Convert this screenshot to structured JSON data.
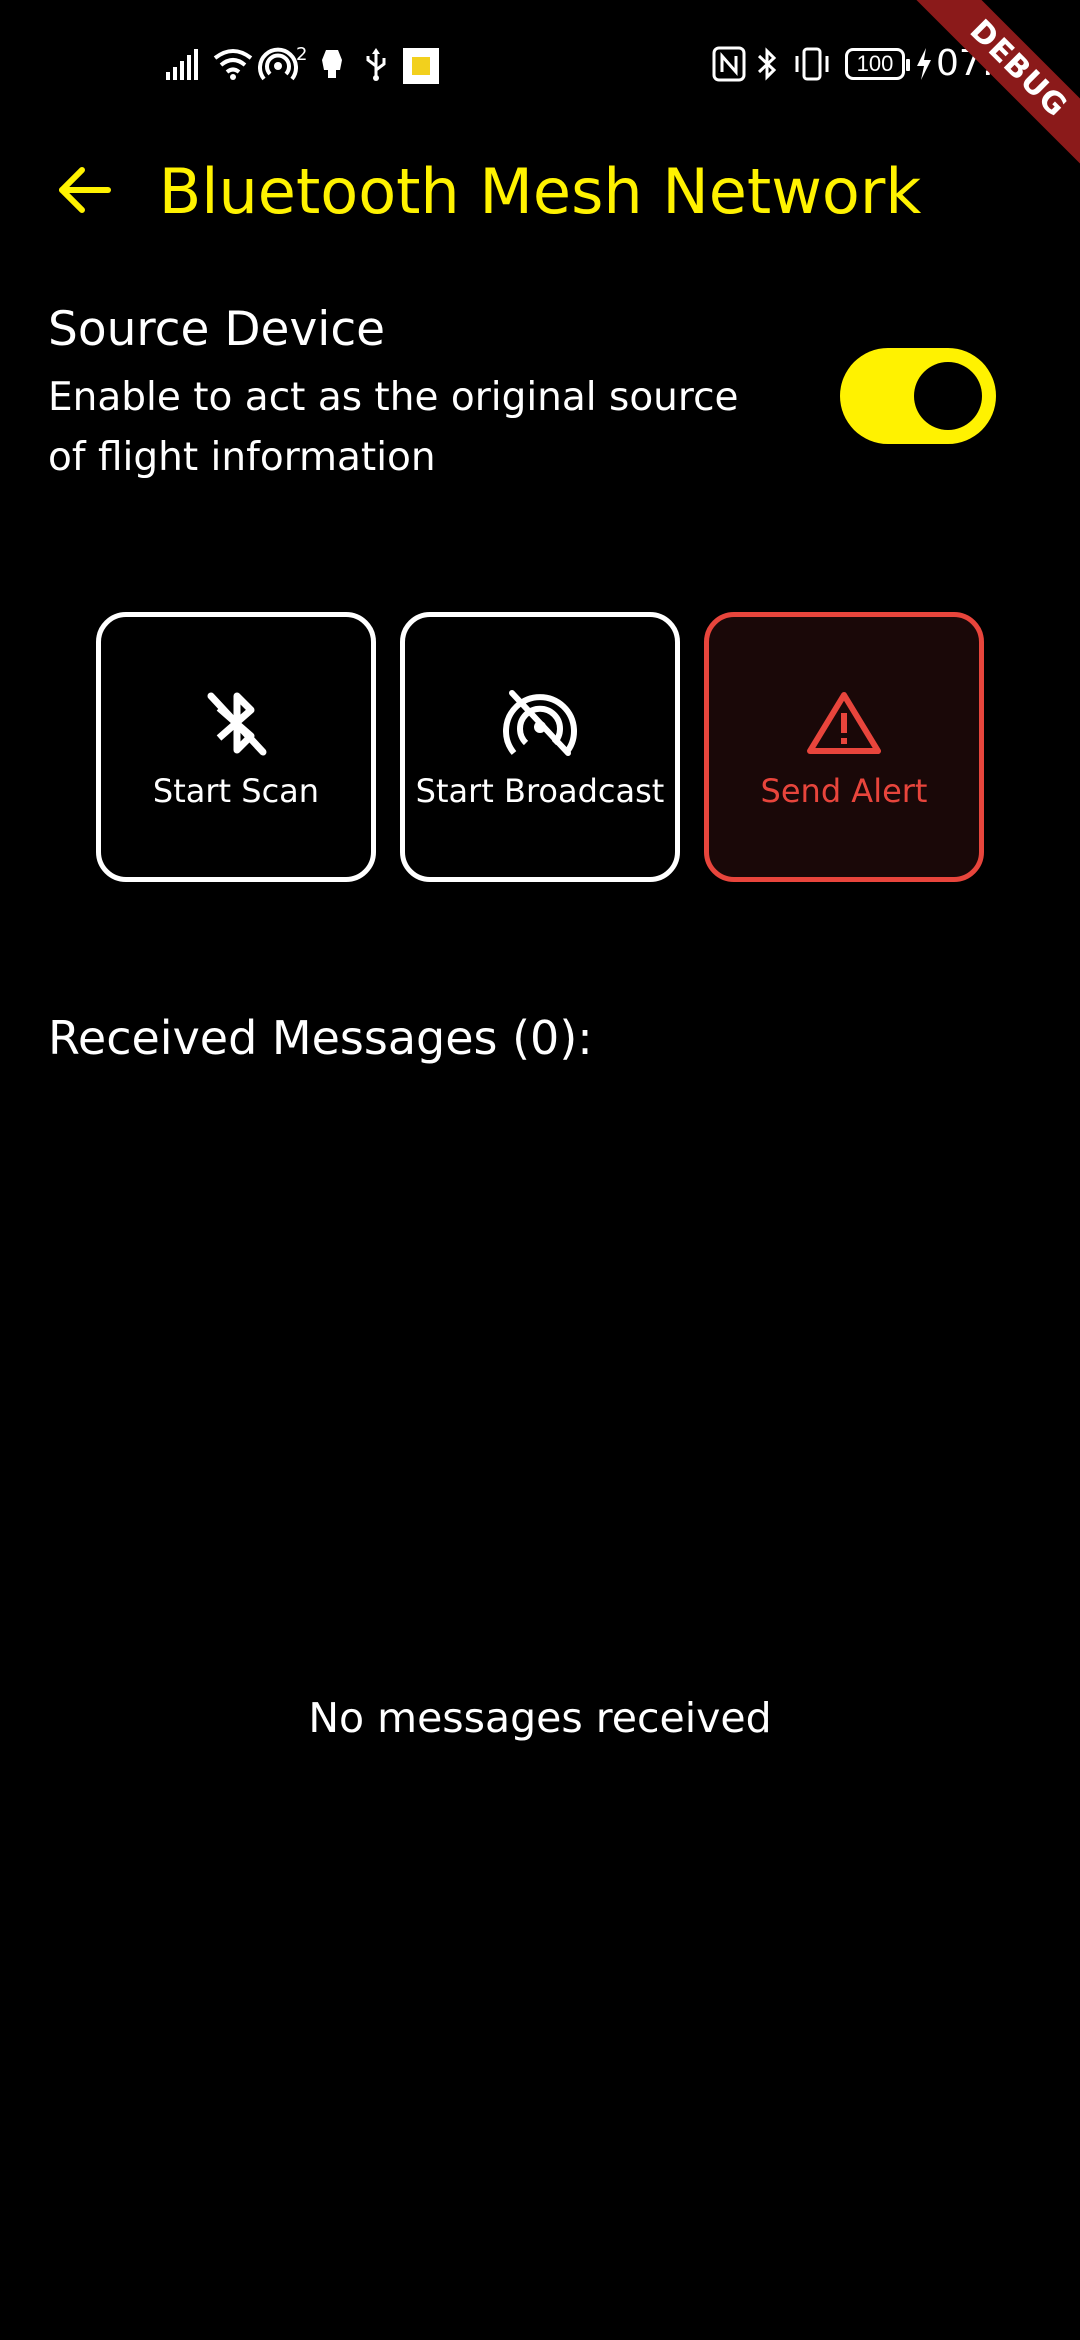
{
  "status_bar": {
    "sim_slot": "2",
    "battery": "100",
    "time": "07:0",
    "icons": [
      "signal-icon",
      "wifi-icon",
      "hotspot-icon",
      "notification-icon",
      "usb-icon",
      "app-notification-icon",
      "nfc-icon",
      "bluetooth-icon",
      "vibrate-icon",
      "battery-icon",
      "charging-icon"
    ]
  },
  "debug_banner": {
    "label": "DEBUG",
    "color": "#8b1a1a"
  },
  "app_bar": {
    "title": "Bluetooth Mesh Network",
    "back_icon": "arrow-back-icon",
    "accent_color": "#fff200"
  },
  "source_device": {
    "title": "Source Device",
    "description": "Enable to act as the original source of flight information",
    "enabled": true
  },
  "actions": [
    {
      "label": "Start Scan",
      "icon": "bluetooth-disabled-icon",
      "color": "#ffffff"
    },
    {
      "label": "Start Broadcast",
      "icon": "broadcast-off-icon",
      "color": "#ffffff"
    },
    {
      "label": "Send Alert",
      "icon": "warning-icon",
      "color": "#e8453c"
    }
  ],
  "messages": {
    "heading": "Received Messages (0):",
    "empty_text": "No messages received"
  }
}
